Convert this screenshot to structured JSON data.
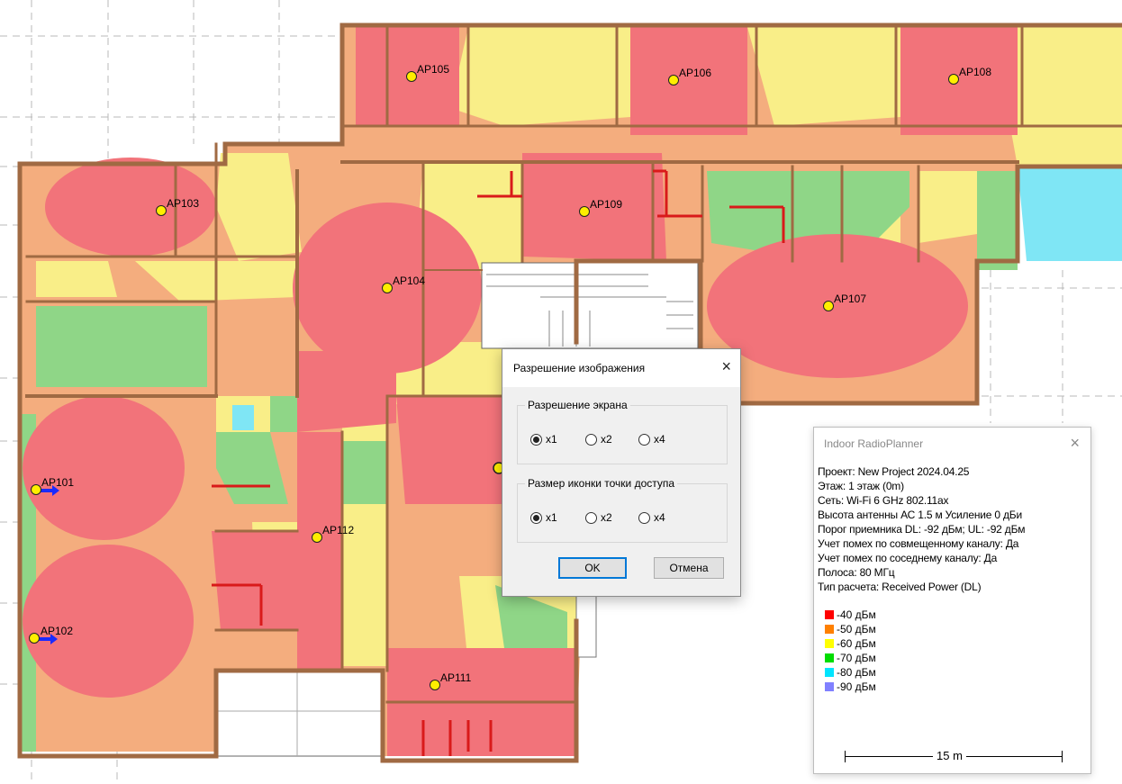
{
  "access_points": [
    {
      "id": "AP101"
    },
    {
      "id": "AP102"
    },
    {
      "id": "AP103"
    },
    {
      "id": "AP104"
    },
    {
      "id": "AP105"
    },
    {
      "id": "AP106"
    },
    {
      "id": "AP107"
    },
    {
      "id": "AP108"
    },
    {
      "id": "AP109"
    },
    {
      "id": "AP111"
    },
    {
      "id": "AP112"
    }
  ],
  "dialog": {
    "title": "Разрешение изображения",
    "close_icon": "×",
    "screen_group": {
      "label": "Разрешение экрана",
      "options": [
        "x1",
        "x2",
        "x4"
      ],
      "selected": "x1"
    },
    "icon_group": {
      "label": "Размер иконки точки доступа",
      "options": [
        "x1",
        "x2",
        "x4"
      ],
      "selected": "x1"
    },
    "ok_label": "OK",
    "cancel_label": "Отмена"
  },
  "info_panel": {
    "title": "Indoor RadioPlanner",
    "close_icon": "×",
    "lines": [
      "Проект: New Project 2024.04.25",
      "Этаж: 1 этаж (0m)",
      "Сеть: Wi-Fi 6 GHz 802.11ax",
      "Высота антенны АС 1.5 м  Усиление 0 дБи",
      "Порог приемника DL: -92 дБм; UL: -92 дБм",
      "Учет помех по совмещенному каналу: Да",
      "Учет помех по соседнему каналу: Да",
      "Полоса: 80 МГц",
      "Тип расчета: Received Power (DL)"
    ],
    "legend": [
      {
        "label": "-40 дБм",
        "color": "#ff0000"
      },
      {
        "label": "-50 дБм",
        "color": "#ff8000"
      },
      {
        "label": "-60 дБм",
        "color": "#ffff00"
      },
      {
        "label": "-70 дБм",
        "color": "#00dd00"
      },
      {
        "label": "-80 дБм",
        "color": "#00e5ff"
      },
      {
        "label": "-90 дБм",
        "color": "#8080ff"
      }
    ],
    "scale_label": "15 m"
  },
  "colors": {
    "strong": "#f2737a",
    "medium": "#f4ad7e",
    "weak": "#f9ee88",
    "low": "#8fd687",
    "very_low": "#7fe6f5",
    "wall": "#a06a43"
  }
}
